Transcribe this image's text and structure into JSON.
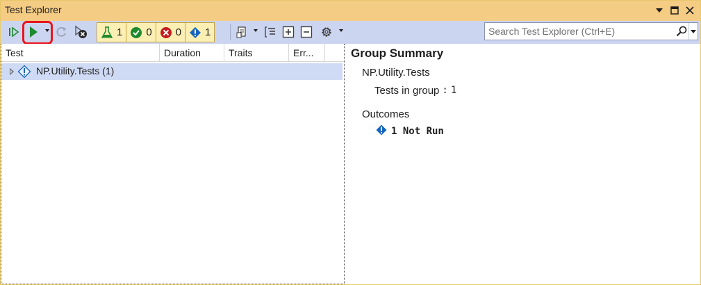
{
  "window": {
    "title": "Test Explorer"
  },
  "toolbar": {
    "counts": {
      "total": "1",
      "passed": "0",
      "failed": "0",
      "not_run": "1"
    },
    "icons": [
      "run-all-icon",
      "run-icon",
      "rerun-failed-icon",
      "cancel-run-icon",
      "playlist-icon",
      "group-by-icon",
      "expand-all-icon",
      "collapse-all-icon",
      "settings-icon"
    ],
    "highlight_color": "#e8151d"
  },
  "search": {
    "placeholder": "Search Test Explorer (Ctrl+E)"
  },
  "columns": [
    "Test",
    "Duration",
    "Traits",
    "Err..."
  ],
  "tree": {
    "rows": [
      {
        "label": "NP.Utility.Tests  (1)",
        "status": "not-run"
      }
    ]
  },
  "summary": {
    "title": "Group Summary",
    "group_name": "NP.Utility.Tests",
    "tests_in_group_label": "Tests in group",
    "tests_in_group_sep": ":",
    "tests_in_group_value": "1",
    "outcomes_label": "Outcomes",
    "not_run_text": "1 Not Run"
  },
  "colors": {
    "title_bar": "#f5cc84",
    "toolbar": "#ccd5f0",
    "selected_row": "#cfdaf4",
    "passed": "#1e8a2e",
    "failed": "#c51d1d",
    "not_run": "#1565c0"
  }
}
